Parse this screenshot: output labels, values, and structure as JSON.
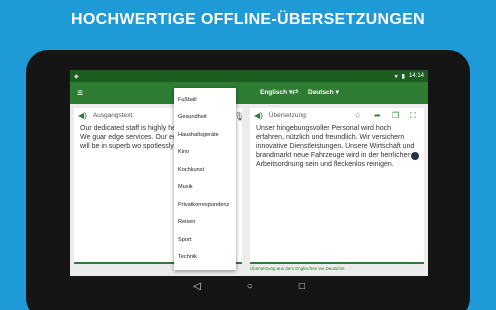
{
  "banner": {
    "title": "HOCHWERTIGE  OFFLINE-ÜBERSETZUNGEN"
  },
  "status": {
    "time": "14:14"
  },
  "appbar": {
    "source_lang": "Englisch",
    "target_lang": "Deutsch"
  },
  "left_panel": {
    "label": "Ausgangstext:",
    "text": "Our dedicated staff is highly helpful and friendly. We guar edge services. Our economy vehicles will be in superb wo spotlessly clean."
  },
  "right_panel": {
    "label": "Übersetzung:",
    "text": "Unser hingebungsvoller Personal wird hoch erfahren, nützlich und freundlich. Wir versichern innovative Dienstleistungen. Unsere Wirtschaft und brandmarkt neue Fahrzeuge wird in der herrlichen Arbeitsordnung sein und fleckenlos reinigen."
  },
  "footer": {
    "note": "Übersetzung aus dem Englischen ins Deutsche"
  },
  "dropdown": {
    "items": [
      "Fußball",
      "Gesundheit",
      "Haushaltsgeräte",
      "Kino",
      "Kochkunst",
      "Musik",
      "Privatkorrespondenz",
      "Reisen",
      "Sport",
      "Technik"
    ]
  },
  "icons": {
    "menu": "hamburger-icon",
    "speaker": "speaker-icon",
    "mic": "microphone-icon",
    "star": "star-icon",
    "share": "share-icon",
    "copy": "copy-icon",
    "fullscreen": "fullscreen-icon"
  }
}
